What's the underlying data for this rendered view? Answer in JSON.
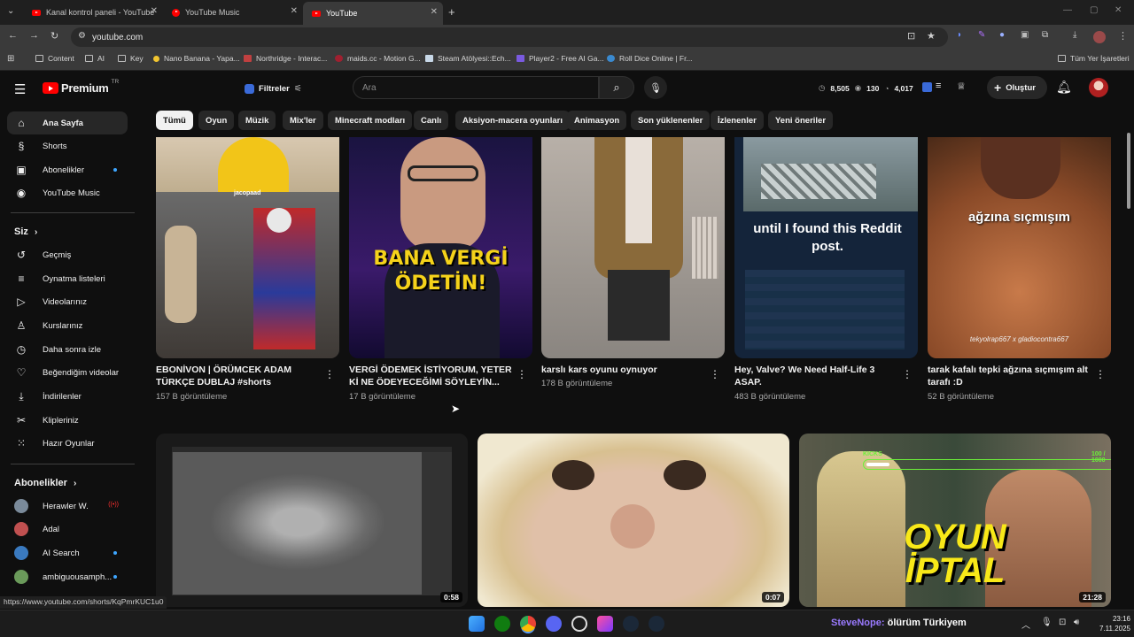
{
  "browser": {
    "tabs": [
      {
        "title": "Kanal kontrol paneli - YouTube",
        "active": false
      },
      {
        "title": "YouTube Music",
        "active": false
      },
      {
        "title": "YouTube",
        "active": true
      }
    ],
    "url": "youtube.com",
    "bookmarks": [
      "Content",
      "AI",
      "Key",
      "Nano Banana - Yapa...",
      "Northridge - Interac...",
      "maids.cc - Motion G...",
      "Steam Atölyesi::Ech...",
      "Player2 - Free AI Ga...",
      "Roll Dice Online | Fr...",
      "Tüm Yer İşaretleri"
    ]
  },
  "header": {
    "logo": "Premium",
    "logo_badge": "TR",
    "filters_label": "Filtreler",
    "search_placeholder": "Ara",
    "stats": [
      "8,505",
      "130",
      "4,017"
    ],
    "create_label": "Oluştur"
  },
  "chips": [
    "Tümü",
    "Oyun",
    "Müzik",
    "Mix'ler",
    "Minecraft modları",
    "Canlı",
    "Aksiyon-macera oyunları",
    "Animasyon",
    "Son yüklenenler",
    "İzlenenler",
    "Yeni öneriler"
  ],
  "sidebar": {
    "main": [
      {
        "label": "Ana Sayfa",
        "icon": "home-icon",
        "glyph": "⌂"
      },
      {
        "label": "Shorts",
        "icon": "shorts-icon",
        "glyph": "§"
      },
      {
        "label": "Abonelikler",
        "icon": "subscriptions-icon",
        "glyph": "▣"
      },
      {
        "label": "YouTube Music",
        "icon": "music-icon",
        "glyph": "◉"
      }
    ],
    "you_header": "Siz",
    "you": [
      {
        "label": "Geçmiş",
        "icon": "history-icon",
        "glyph": "↺"
      },
      {
        "label": "Oynatma listeleri",
        "icon": "playlists-icon",
        "glyph": "≡"
      },
      {
        "label": "Videolarınız",
        "icon": "your-videos-icon",
        "glyph": "▷"
      },
      {
        "label": "Kurslarınız",
        "icon": "courses-icon",
        "glyph": "♙"
      },
      {
        "label": "Daha sonra izle",
        "icon": "watch-later-icon",
        "glyph": "◷"
      },
      {
        "label": "Beğendiğim videolar",
        "icon": "like-icon",
        "glyph": "♡"
      },
      {
        "label": "İndirilenler",
        "icon": "download-icon",
        "glyph": "⤓"
      },
      {
        "label": "Klipleriniz",
        "icon": "clips-icon",
        "glyph": "✂"
      },
      {
        "label": "Hazır Oyunlar",
        "icon": "playables-icon",
        "glyph": "⁙"
      }
    ],
    "subs_header": "Abonelikler",
    "subs": [
      {
        "label": "Herawler W.",
        "color": "#7a8a9a"
      },
      {
        "label": "Adal",
        "color": "#c05050"
      },
      {
        "label": "AI Search",
        "color": "#3a7ac0"
      },
      {
        "label": "ambiguousamph...",
        "color": "#6a9a5a"
      }
    ]
  },
  "shorts": [
    {
      "title": "EBONİVON | ÖRÜMCEK ADAM TÜRKÇE DUBLAJ #shorts",
      "views": "157 B görüntüleme",
      "overlay": "jacopaad"
    },
    {
      "title": "VERGİ ÖDEMEK İSTİYORUM, YETER Kİ NE ÖDEYECEĞİMİ SÖYLEYİN...",
      "views": "17 B görüntüleme",
      "overlay": "BANA VERGİ ÖDETİN!"
    },
    {
      "title": "karslı kars oyunu oynuyor",
      "views": "178 B görüntüleme",
      "overlay": ""
    },
    {
      "title": "Hey, Valve? We Need Half-Life 3 ASAP.",
      "views": "483 B görüntüleme",
      "overlay": "until I found this Reddit post."
    },
    {
      "title": "tarak kafalı tepki ağzına sıçmışım alt tarafı :D",
      "views": "52 B görüntüleme",
      "overlay": "ağzına sıçmışım",
      "credit": "tekyolrap667 x gladiocontra667"
    }
  ],
  "videos": [
    {
      "duration": "0:58"
    },
    {
      "duration": "0:07"
    },
    {
      "duration": "21:28",
      "overlay": "OYUN İPTAL",
      "hud_left": "KICKS",
      "hud_right": "100 / 1000"
    }
  ],
  "status_url": "https://www.youtube.com/shorts/KqPmrKUC1u0",
  "taskbar": {
    "now_playing_user": "SteveNope:",
    "now_playing_text": "ölürüm Türkiyem",
    "time": "23:16",
    "date": "7.11.2025"
  }
}
